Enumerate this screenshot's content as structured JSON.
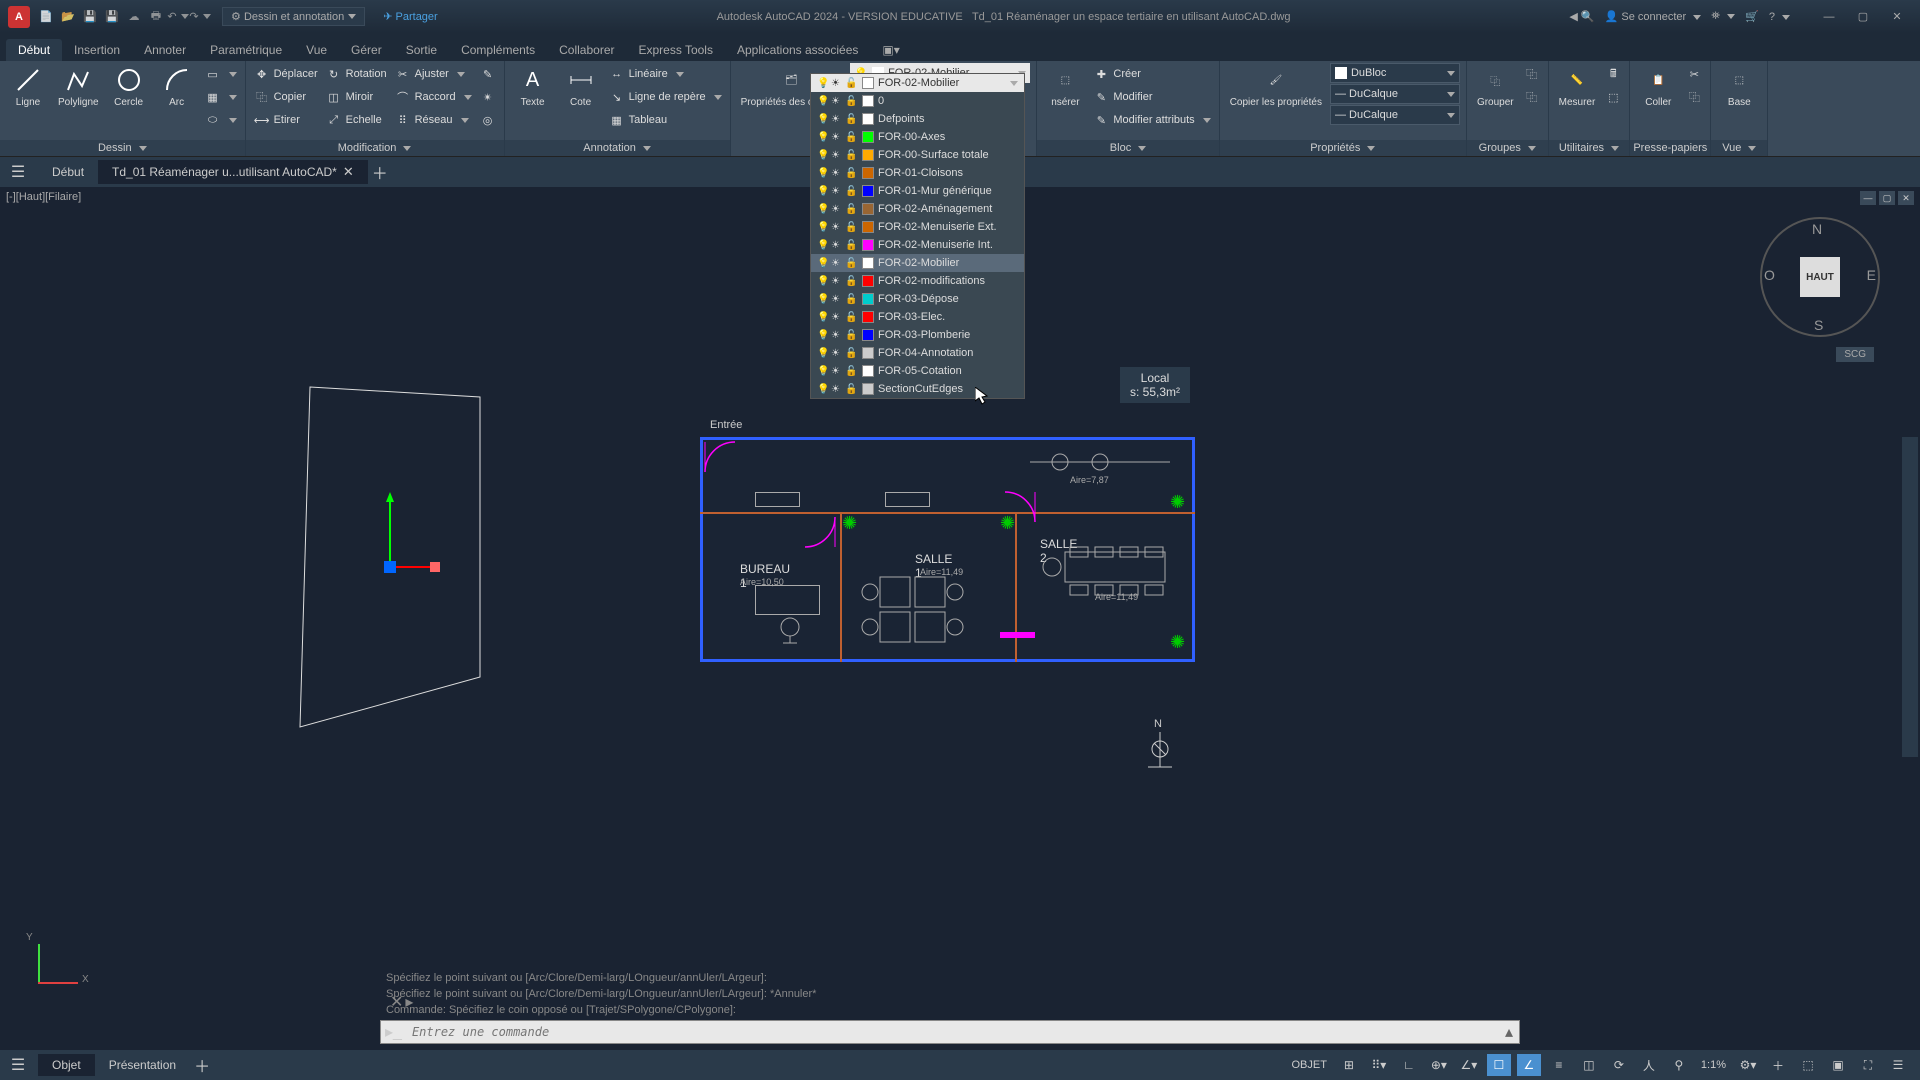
{
  "titlebar": {
    "app_letter": "A",
    "workspace": "Dessin et annotation",
    "share": "Partager",
    "app_title": "Autodesk AutoCAD 2024 - VERSION EDUCATIVE",
    "doc_title": "Td_01 Réaménager un espace tertiaire en utilisant AutoCAD.dwg",
    "signin": "Se connecter"
  },
  "menutabs": [
    "Début",
    "Insertion",
    "Annoter",
    "Paramétrique",
    "Vue",
    "Gérer",
    "Sortie",
    "Compléments",
    "Collaborer",
    "Express Tools",
    "Applications associées"
  ],
  "ribbon": {
    "dessin": {
      "title": "Dessin",
      "ligne": "Ligne",
      "polyligne": "Polyligne",
      "cercle": "Cercle",
      "arc": "Arc"
    },
    "modification": {
      "title": "Modification",
      "deplacer": "Déplacer",
      "copier": "Copier",
      "etirer": "Etirer",
      "rotation": "Rotation",
      "miroir": "Miroir",
      "echelle": "Echelle",
      "ajuster": "Ajuster",
      "raccord": "Raccord",
      "reseau": "Réseau"
    },
    "annotation": {
      "title": "Annotation",
      "texte": "Texte",
      "cote": "Cote",
      "lineaire": "Linéaire",
      "repere": "Ligne de repère",
      "tableau": "Tableau"
    },
    "calques": {
      "title": "Propriétés des calques",
      "btn": "Propriétés\ndes calques"
    },
    "bloc": {
      "title": "Bloc",
      "inserer": "nsérer",
      "creer": "Créer",
      "modifier": "Modifier",
      "mod_attr": "Modifier attributs"
    },
    "proprietes": {
      "title": "Propriétés",
      "copier": "Copier\nles propriétés",
      "bylayer": "DuBloc",
      "bylayer2": "DuCalque",
      "bylayer3": "DuCalque"
    },
    "groupes": {
      "title": "Groupes",
      "btn": "Grouper"
    },
    "utilitaires": {
      "title": "Utilitaires",
      "btn": "Mesurer"
    },
    "presse": {
      "title": "Presse-papiers",
      "btn": "Coller"
    },
    "vue": {
      "title": "Vue",
      "btn": "Base"
    }
  },
  "filetabs": {
    "debut": "Début",
    "current": "Td_01 Réaménager u...utilisant AutoCAD*"
  },
  "viewport": {
    "label": "[-][Haut][Filaire]",
    "cube": "HAUT",
    "n": "N",
    "s": "S",
    "e": "E",
    "o": "O",
    "scg": "SCG"
  },
  "layers": {
    "selected": "FOR-02-Mobilier",
    "items": [
      {
        "name": "0",
        "color": "#ffffff"
      },
      {
        "name": "Defpoints",
        "color": "#ffffff"
      },
      {
        "name": "FOR-00-Axes",
        "color": "#00ff00"
      },
      {
        "name": "FOR-00-Surface totale",
        "color": "#ffaa00"
      },
      {
        "name": "FOR-01-Cloisons",
        "color": "#cc6600"
      },
      {
        "name": "FOR-01-Mur générique",
        "color": "#0000ff"
      },
      {
        "name": "FOR-02-Aménagement",
        "color": "#996633"
      },
      {
        "name": "FOR-02-Menuiserie Ext.",
        "color": "#cc6600"
      },
      {
        "name": "FOR-02-Menuiserie Int.",
        "color": "#ff00ff"
      },
      {
        "name": "FOR-02-Mobilier",
        "color": "#ffffff",
        "hl": true
      },
      {
        "name": "FOR-02-modifications",
        "color": "#ff0000"
      },
      {
        "name": "FOR-03-Dépose",
        "color": "#00cccc"
      },
      {
        "name": "FOR-03-Elec.",
        "color": "#ff0000"
      },
      {
        "name": "FOR-03-Plomberie",
        "color": "#0000ff"
      },
      {
        "name": "FOR-04-Annotation",
        "color": "#cccccc"
      },
      {
        "name": "FOR-05-Cotation",
        "color": "#ffffff"
      },
      {
        "name": "SectionCutEdges",
        "color": "#cccccc"
      }
    ]
  },
  "plan": {
    "entree": "Entrée",
    "bureau1": "BUREAU 1",
    "salle1": "SALLE 1",
    "salle2": "SALLE 2",
    "aire_b1": "Aire=10,50",
    "aire_s1": "Aire=11,49",
    "aire_s2": "Aire=11,49",
    "aire_top": "Aire=7,87",
    "local": "Local",
    "local_s": "s: 55,3m²"
  },
  "cmd": {
    "h1": "Spécifiez le point suivant ou [Arc/Clore/Demi-larg/LOngueur/annUler/LArgeur]:",
    "h2": "Spécifiez le point suivant ou [Arc/Clore/Demi-larg/LOngueur/annUler/LArgeur]: *Annuler*",
    "h3": "Commande: Spécifiez le coin opposé ou [Trajet/SPolygone/CPolygone]:",
    "placeholder": "Entrez une commande"
  },
  "layouttabs": {
    "objet": "Objet",
    "presentation": "Présentation"
  },
  "status": {
    "objet": "OBJET",
    "scale": "1:1%"
  }
}
